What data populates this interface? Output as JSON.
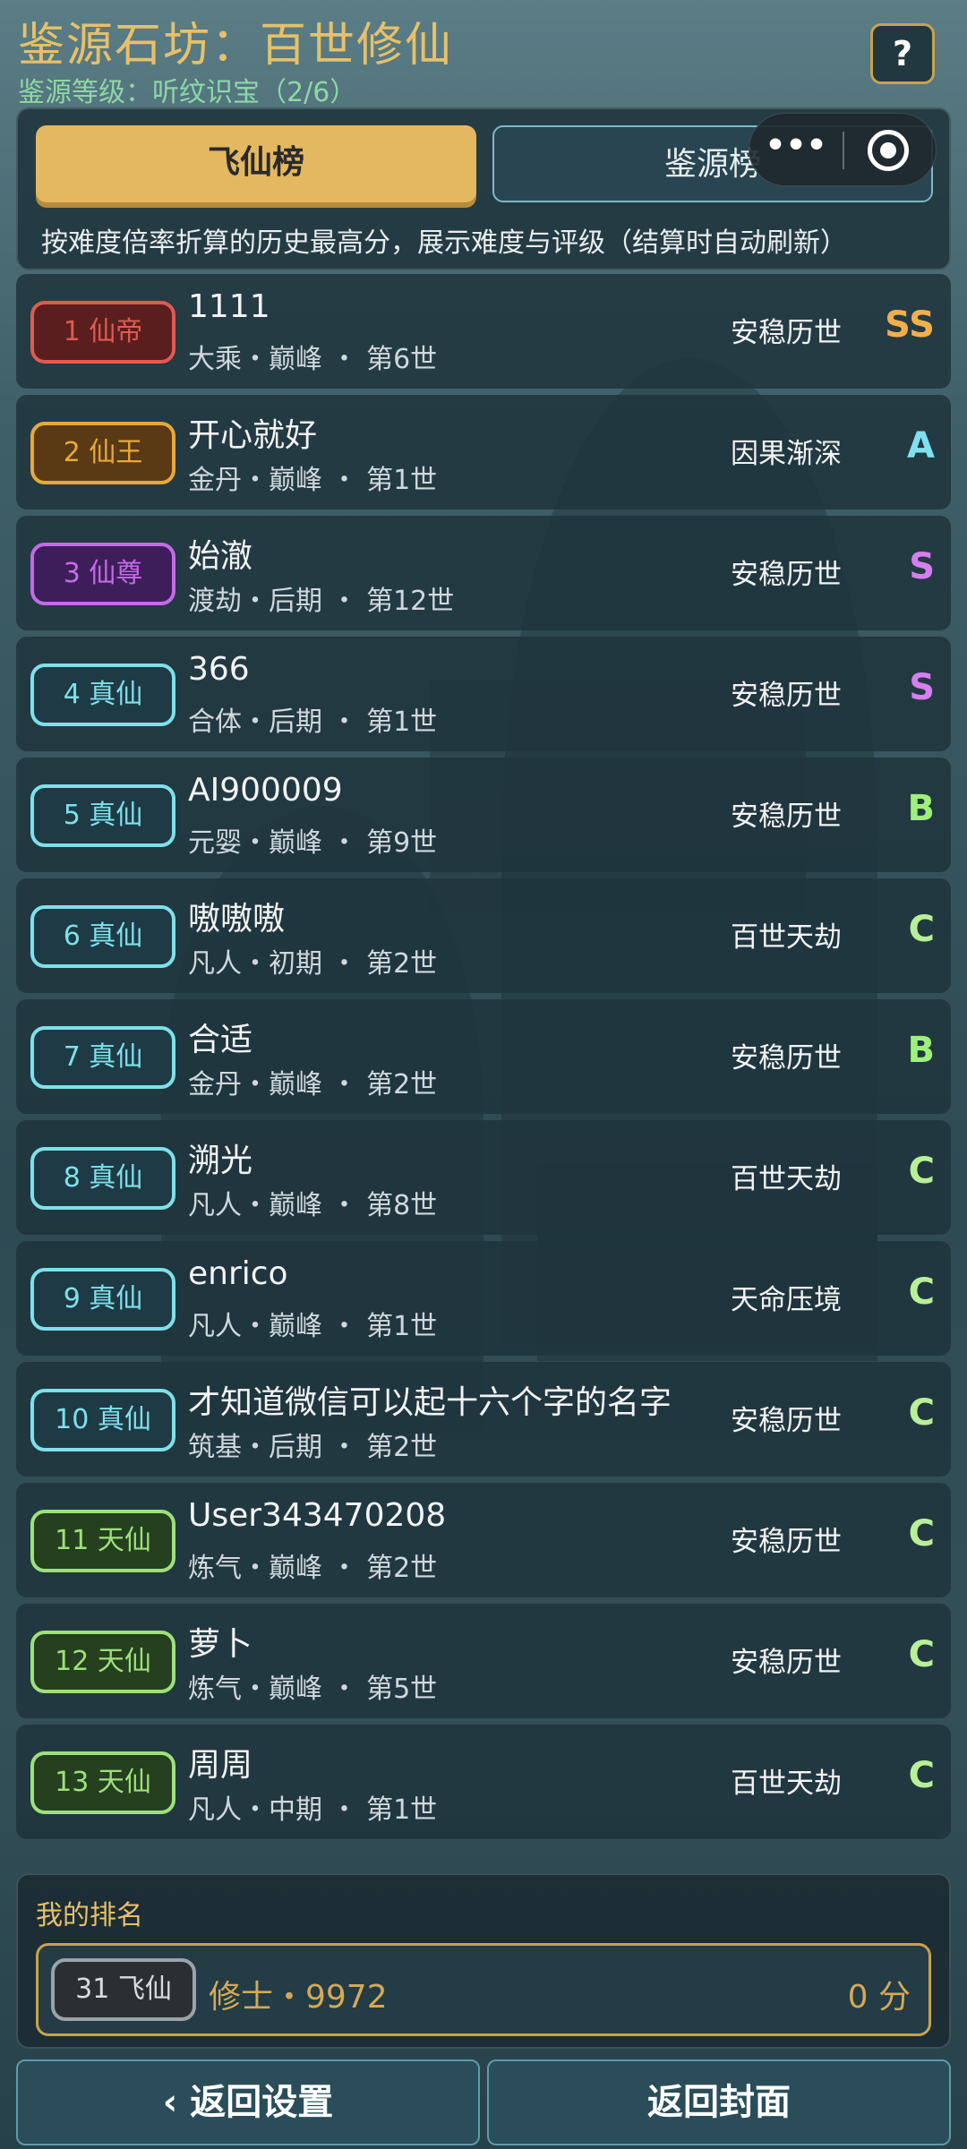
{
  "header": {
    "title": "鉴源石坊：百世修仙",
    "level": "鉴源等级：听纹识宝（2/6）",
    "help_label": "?",
    "more_label": "•••"
  },
  "tabs": [
    {
      "label": "飞仙榜",
      "active": true
    },
    {
      "label": "鉴源榜",
      "active": false
    }
  ],
  "description": "按难度倍率折算的历史最高分，展示难度与评级（结算时自动刷新）",
  "leaderboard": [
    {
      "rank": "1 仙帝",
      "name": "1111",
      "info": "大乘・巅峰 ・ 第6世",
      "difficulty": "安稳历世",
      "grade": "SS",
      "badge_color": "#e05a50",
      "badge_bg": "#5a1e1e",
      "grade_color": "#f2b04a"
    },
    {
      "rank": "2 仙王",
      "name": "开心就好",
      "info": "金丹・巅峰 ・ 第1世",
      "difficulty": "因果渐深",
      "grade": "A",
      "badge_color": "#e8a83a",
      "badge_bg": "#5a3a14",
      "grade_color": "#7fe0f0"
    },
    {
      "rank": "3 仙尊",
      "name": "始澈",
      "info": "渡劫・后期 ・ 第12世",
      "difficulty": "安稳历世",
      "grade": "S",
      "badge_color": "#c46ae8",
      "badge_bg": "#3e1e5a",
      "grade_color": "#d67ef0"
    },
    {
      "rank": "4 真仙",
      "name": "366",
      "info": "合体・后期 ・ 第1世",
      "difficulty": "安稳历世",
      "grade": "S",
      "badge_color": "#7ee0ea",
      "badge_bg": "#1e3a44",
      "grade_color": "#d67ef0"
    },
    {
      "rank": "5 真仙",
      "name": "AI900009",
      "info": "元婴・巅峰 ・ 第9世",
      "difficulty": "安稳历世",
      "grade": "B",
      "badge_color": "#7ee0ea",
      "badge_bg": "#1e3a44",
      "grade_color": "#9ef07a"
    },
    {
      "rank": "6 真仙",
      "name": "嗷嗷嗷",
      "info": "凡人・初期 ・ 第2世",
      "difficulty": "百世天劫",
      "grade": "C",
      "badge_color": "#7ee0ea",
      "badge_bg": "#1e3a44",
      "grade_color": "#b8f098"
    },
    {
      "rank": "7 真仙",
      "name": "合适",
      "info": "金丹・巅峰 ・ 第2世",
      "difficulty": "安稳历世",
      "grade": "B",
      "badge_color": "#7ee0ea",
      "badge_bg": "#1e3a44",
      "grade_color": "#9ef07a"
    },
    {
      "rank": "8 真仙",
      "name": "溯光",
      "info": "凡人・巅峰 ・ 第8世",
      "difficulty": "百世天劫",
      "grade": "C",
      "badge_color": "#7ee0ea",
      "badge_bg": "#1e3a44",
      "grade_color": "#b8f098"
    },
    {
      "rank": "9 真仙",
      "name": "enrico",
      "info": "凡人・巅峰 ・ 第1世",
      "difficulty": "天命压境",
      "grade": "C",
      "badge_color": "#7ee0ea",
      "badge_bg": "#1e3a44",
      "grade_color": "#b8f098"
    },
    {
      "rank": "10 真仙",
      "name": "才知道微信可以起十六个字的名字",
      "info": "筑基・后期 ・ 第2世",
      "difficulty": "安稳历世",
      "grade": "C",
      "badge_color": "#7ee0ea",
      "badge_bg": "#1e3a44",
      "grade_color": "#b8f098"
    },
    {
      "rank": "11 天仙",
      "name": "User343470208",
      "info": "炼气・巅峰 ・ 第2世",
      "difficulty": "安稳历世",
      "grade": "C",
      "badge_color": "#9ee07a",
      "badge_bg": "#24401e",
      "grade_color": "#b8f098"
    },
    {
      "rank": "12 天仙",
      "name": "萝卜",
      "info": "炼气・巅峰 ・ 第5世",
      "difficulty": "安稳历世",
      "grade": "C",
      "badge_color": "#9ee07a",
      "badge_bg": "#24401e",
      "grade_color": "#b8f098"
    },
    {
      "rank": "13 天仙",
      "name": "周周",
      "info": "凡人・中期 ・ 第1世",
      "difficulty": "百世天劫",
      "grade": "C",
      "badge_color": "#9ee07a",
      "badge_bg": "#24401e",
      "grade_color": "#b8f098"
    }
  ],
  "my_rank": {
    "label": "我的排名",
    "rank": "31 飞仙",
    "name": "修士・9972",
    "score": "0 分"
  },
  "buttons": {
    "back_settings": "‹ 返回设置",
    "back_cover": "返回封面"
  }
}
